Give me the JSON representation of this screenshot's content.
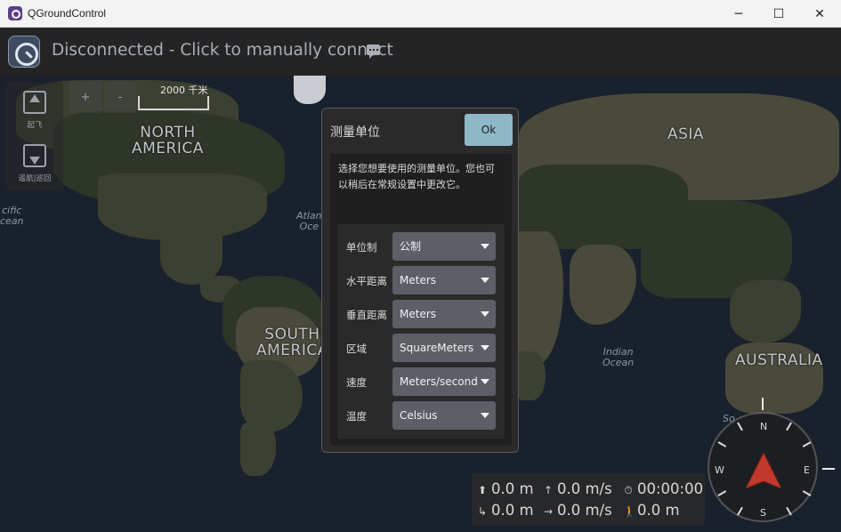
{
  "window": {
    "title": "QGroundControl",
    "minimize_glyph": "─",
    "maximize_glyph": "☐",
    "close_glyph": "✕"
  },
  "toolbar": {
    "connection_status": "Disconnected - Click to manually connect"
  },
  "map": {
    "labels": {
      "north_america_1": "NORTH",
      "north_america_2": "AMERICA",
      "south_america_1": "SOUTH",
      "south_america_2": "AMERICA",
      "asia": "ASIA",
      "australia": "AUSTRALIA",
      "atlantic_1": "Atlan",
      "atlantic_2": "Oce",
      "pacific_1": "cific",
      "pacific_2": "cean",
      "indian_1": "Indian",
      "indian_2": "Ocean",
      "southern": "So"
    },
    "scale": "2000 千米",
    "zoom_in": "+",
    "zoom_out": "-"
  },
  "tools": {
    "takeoff": "起飞",
    "plan": "遥航|巡回"
  },
  "dialog": {
    "title": "测量单位",
    "ok": "Ok",
    "description": "选择您想要使用的测量单位。您也可以稍后在常规设置中更改它。",
    "fields": [
      {
        "label": "单位制",
        "value": "公制"
      },
      {
        "label": "水平距离",
        "value": "Meters"
      },
      {
        "label": "垂直距离",
        "value": "Meters"
      },
      {
        "label": "区域",
        "value": "SquareMeters"
      },
      {
        "label": "速度",
        "value": "Meters/second"
      },
      {
        "label": "温度",
        "value": "Celsius"
      }
    ]
  },
  "telemetry": {
    "altitude": "0.0 m",
    "vertical_speed": "0.0 m/s",
    "flight_time": "00:00:00",
    "distance_home": "0.0 m",
    "ground_speed": "0.0 m/s",
    "distance": "0.0 m"
  },
  "compass": {
    "north": "N",
    "east": "E",
    "south": "S",
    "west": "W",
    "needle_color": "#c0392b"
  }
}
